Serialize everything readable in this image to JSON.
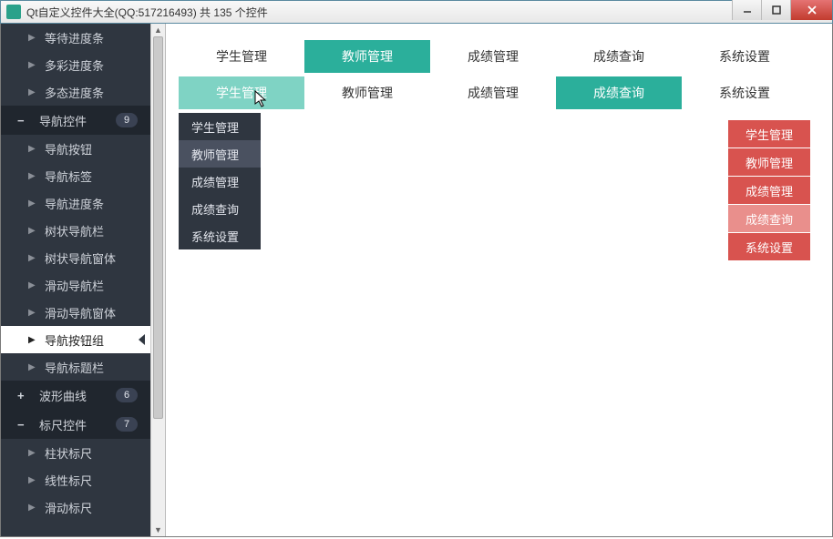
{
  "window": {
    "title": "Qt自定义控件大全(QQ:517216493) 共 135 个控件"
  },
  "sidebar": {
    "items": [
      {
        "type": "child",
        "label": "等待进度条"
      },
      {
        "type": "child",
        "label": "多彩进度条"
      },
      {
        "type": "child",
        "label": "多态进度条"
      },
      {
        "type": "group",
        "label": "导航控件",
        "icon": "−",
        "badge": "9"
      },
      {
        "type": "child",
        "label": "导航按钮"
      },
      {
        "type": "child",
        "label": "导航标签"
      },
      {
        "type": "child",
        "label": "导航进度条"
      },
      {
        "type": "child",
        "label": "树状导航栏"
      },
      {
        "type": "child",
        "label": "树状导航窗体"
      },
      {
        "type": "child",
        "label": "滑动导航栏"
      },
      {
        "type": "child",
        "label": "滑动导航窗体"
      },
      {
        "type": "child",
        "label": "导航按钮组",
        "selected": true
      },
      {
        "type": "child",
        "label": "导航标题栏"
      },
      {
        "type": "group",
        "label": "波形曲线",
        "icon": "+",
        "badge": "6"
      },
      {
        "type": "group",
        "label": "标尺控件",
        "icon": "−",
        "badge": "7"
      },
      {
        "type": "child",
        "label": "柱状标尺"
      },
      {
        "type": "child",
        "label": "线性标尺"
      },
      {
        "type": "child",
        "label": "滑动标尺"
      }
    ]
  },
  "navRow1": [
    "学生管理",
    "教师管理",
    "成绩管理",
    "成绩查询",
    "系统设置"
  ],
  "navRow1ActiveIndex": 1,
  "navRow2": [
    "学生管理",
    "教师管理",
    "成绩管理",
    "成绩查询",
    "系统设置"
  ],
  "navRow2ActiveIndex": 0,
  "navRow2TealIndex": 3,
  "dropdown": {
    "items": [
      "学生管理",
      "教师管理",
      "成绩管理",
      "成绩查询",
      "系统设置"
    ],
    "hoverIndex": 1
  },
  "redNav": {
    "items": [
      "学生管理",
      "教师管理",
      "成绩管理",
      "成绩查询",
      "系统设置"
    ],
    "lightIndex": 3
  }
}
